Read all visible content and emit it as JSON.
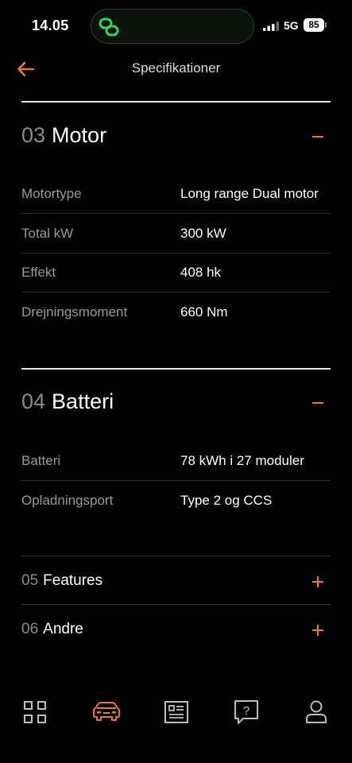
{
  "status_bar": {
    "time": "14.05",
    "network": "5G",
    "battery": "85"
  },
  "header": {
    "title": "Specifikationer",
    "back_icon": "arrow-left-icon"
  },
  "colors": {
    "accent": "#e8782a",
    "background": "#000000",
    "island_green": "#39d24a"
  },
  "sections": {
    "motor": {
      "number": "03",
      "title": "Motor",
      "rows": [
        {
          "label": "Motortype",
          "value": "Long range Dual motor"
        },
        {
          "label": "Total kW",
          "value": "300 kW"
        },
        {
          "label": "Effekt",
          "value": "408 hk"
        },
        {
          "label": "Drejningsmoment",
          "value": "660 Nm"
        }
      ]
    },
    "battery": {
      "number": "04",
      "title": "Batteri",
      "rows": [
        {
          "label": "Batteri",
          "value": "78 kWh i 27 moduler"
        },
        {
          "label": "Opladningsport",
          "value": "Type 2 og CCS"
        }
      ]
    },
    "features": {
      "number": "05",
      "title": "Features"
    },
    "other": {
      "number": "06",
      "title": "Andre"
    }
  },
  "tabbar": {
    "items": [
      {
        "name": "grid-icon",
        "active": false
      },
      {
        "name": "car-icon",
        "active": true
      },
      {
        "name": "spec-sheet-icon",
        "active": false
      },
      {
        "name": "help-icon",
        "active": false
      },
      {
        "name": "profile-icon",
        "active": false
      }
    ]
  }
}
